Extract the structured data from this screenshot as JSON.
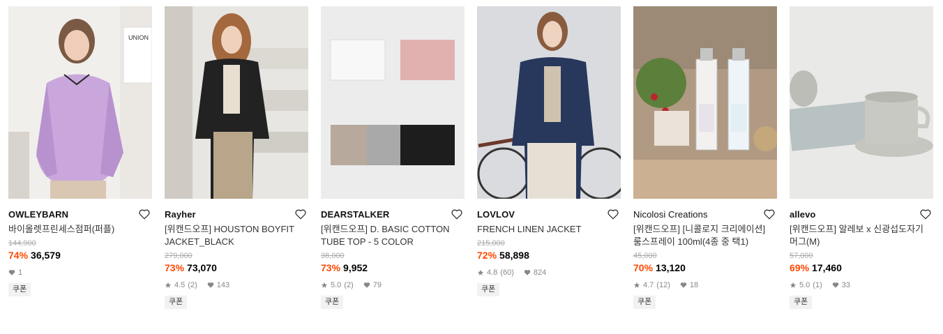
{
  "products": [
    {
      "brand": "OWLEYBARN",
      "title": "바이올렛프린세스점퍼(퍼플)",
      "original_price": "144,900",
      "discount": "74%",
      "price": "36,579",
      "likes": "1",
      "coupon": "쿠폰"
    },
    {
      "brand": "Rayher",
      "title": "[위캔드오프] HOUSTON BOYFIT JACKET_BLACK",
      "original_price": "279,000",
      "discount": "73%",
      "price": "73,070",
      "rating": "4.5",
      "reviews": "(2)",
      "likes": "143",
      "coupon": "쿠폰"
    },
    {
      "brand": "DEARSTALKER",
      "title": "[위캔드오프] D. BASIC COTTON TUBE TOP - 5 COLOR",
      "original_price": "38,000",
      "discount": "73%",
      "price": "9,952",
      "rating": "5.0",
      "reviews": "(2)",
      "likes": "79",
      "coupon": "쿠폰"
    },
    {
      "brand": "LOVLOV",
      "title": "FRENCH LINEN JACKET",
      "original_price": "215,000",
      "discount": "72%",
      "price": "58,898",
      "rating": "4.8",
      "reviews": "(60)",
      "likes": "824",
      "coupon": "쿠폰"
    },
    {
      "brand": "Nicolosi Creations",
      "title": "[위캔드오프] [니콜로지 크리에이션] 룸스프레이 100ml(4종 중 택1)",
      "original_price": "45,000",
      "discount": "70%",
      "price": "13,120",
      "rating": "4.7",
      "reviews": "(12)",
      "likes": "18",
      "coupon": "쿠폰"
    },
    {
      "brand": "allevo",
      "title": "[위캔드오프] 알레보 x 신광섭도자기 머그(M)",
      "original_price": "57,000",
      "discount": "69%",
      "price": "17,460",
      "rating": "5.0",
      "reviews": "(1)",
      "likes": "33",
      "coupon": "쿠폰"
    }
  ],
  "thumb_text": {
    "union_sign": "UNION"
  },
  "colors": {
    "discount": "#ff4800",
    "coupon_bg": "#f2f2f2",
    "muted": "#888888"
  },
  "icons": [
    "heart-icon",
    "star-icon",
    "heart-filled-icon"
  ]
}
